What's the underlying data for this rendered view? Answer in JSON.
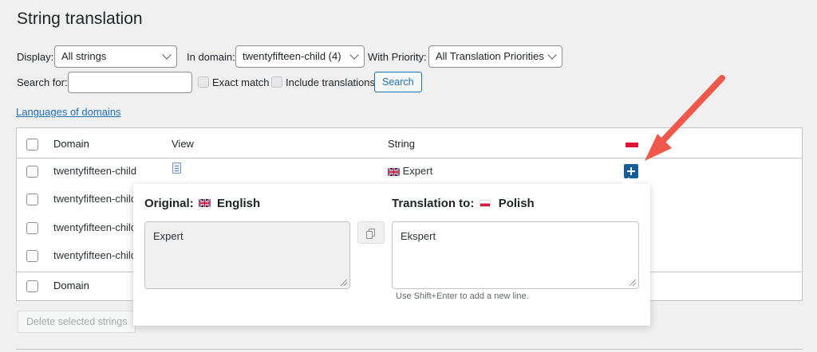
{
  "page": {
    "title": "String translation"
  },
  "filters": {
    "display_label": "Display:",
    "display_value": "All strings",
    "domain_label": "In domain:",
    "domain_value": "twentyfifteen-child (4)",
    "priority_label": "With Priority:",
    "priority_value": "All Translation Priorities",
    "search_label": "Search for:",
    "search_value": "",
    "exact_match": "Exact match",
    "include_translations": "Include translations",
    "search_button": "Search"
  },
  "links": {
    "languages_of_domains": "Languages of domains"
  },
  "table": {
    "headers": {
      "domain": "Domain",
      "view": "View",
      "string": "String"
    },
    "rows": [
      {
        "domain": "twentyfifteen-child",
        "string": "Expert"
      },
      {
        "domain": "twentyfifteen-child"
      },
      {
        "domain": "twentyfifteen-child"
      },
      {
        "domain": "twentyfifteen-child"
      }
    ],
    "footer_domain": "Domain"
  },
  "popup": {
    "original_label": "Original:",
    "original_lang": "English",
    "original_text": "Expert",
    "translation_label": "Translation to:",
    "translation_lang": "Polish",
    "translation_text": "Ekspert",
    "hint": "Use Shift+Enter to add a new line."
  },
  "actions": {
    "delete_selected": "Delete selected strings"
  },
  "colors": {
    "accent": "#2271b1",
    "arrow": "#f0584b",
    "plus_button": "#135e96",
    "pl_red": "#dc143c"
  },
  "icons": [
    "chevron-down-icon",
    "document-icon",
    "uk-flag-icon",
    "pl-flag-icon",
    "plus-icon",
    "copy-icon",
    "resize-grip-icon",
    "arrow-annotation-icon"
  ]
}
